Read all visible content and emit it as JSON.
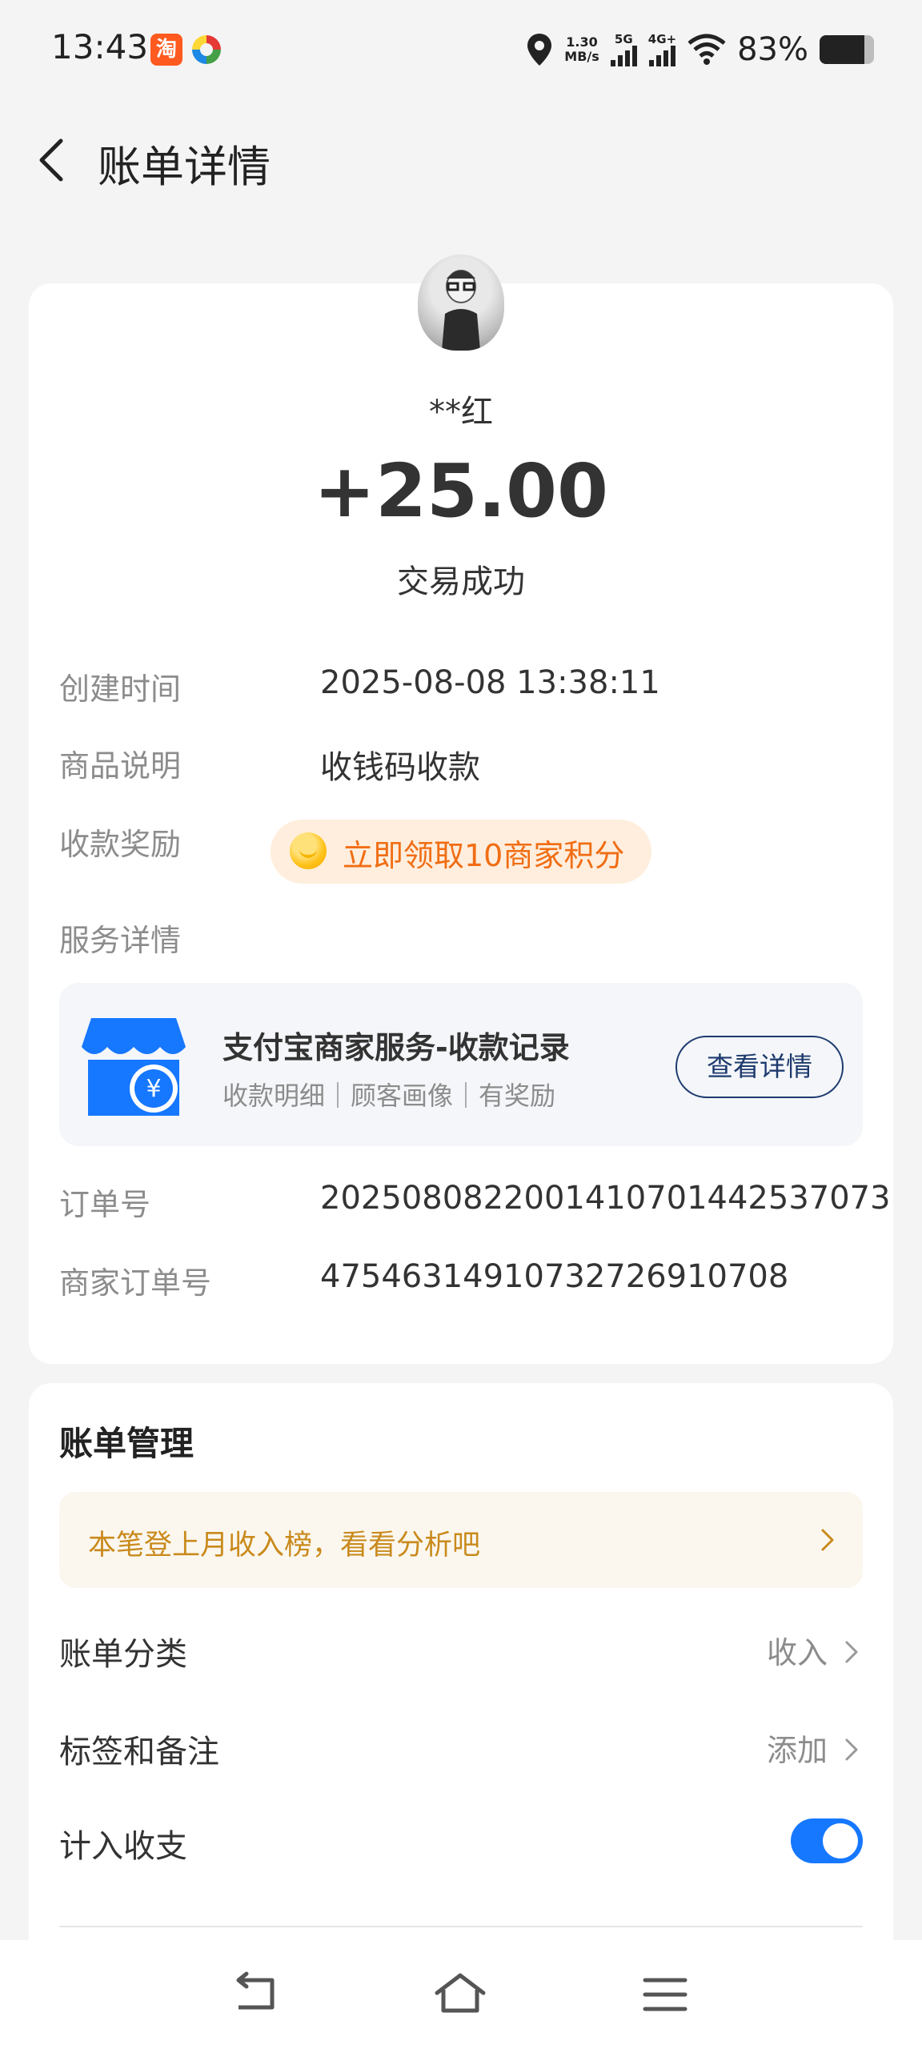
{
  "status_bar": {
    "time": "13:43",
    "taobao_glyph": "淘",
    "net_speed_value": "1.30",
    "net_speed_unit": "MB/s",
    "sim1_label": "5G",
    "sim2_label": "4G+",
    "battery_text": "83%",
    "battery_level": 0.83
  },
  "header": {
    "title": "账单详情"
  },
  "transaction": {
    "payer_name": "**红",
    "amount": "+25.00",
    "status": "交易成功"
  },
  "details": {
    "created_label": "创建时间",
    "created_value": "2025-08-08 13:38:11",
    "goods_label": "商品说明",
    "goods_value": "收钱码收款",
    "reward_label": "收款奖励",
    "reward_text": "立即领取10商家积分",
    "service_label": "服务详情",
    "order_label": "订单号",
    "order_value": "2025080822001410701442537073",
    "merchant_order_label": "商家订单号",
    "merchant_order_value": "47546314910732726910708"
  },
  "service_card": {
    "title": "支付宝商家服务-收款记录",
    "subtitle": "收款明细｜顾客画像｜有奖励",
    "button_label": "查看详情"
  },
  "bill_management": {
    "title": "账单管理",
    "tip_text": "本笔登上月收入榜，看看分析吧",
    "category_label": "账单分类",
    "category_value": "收入",
    "tags_label": "标签和备注",
    "tags_value": "添加",
    "count_label": "计入收支",
    "count_enabled": true
  },
  "colors": {
    "accent_blue": "#1677ff",
    "reward_orange": "#f06d14",
    "tip_gold": "#c98a1c"
  }
}
